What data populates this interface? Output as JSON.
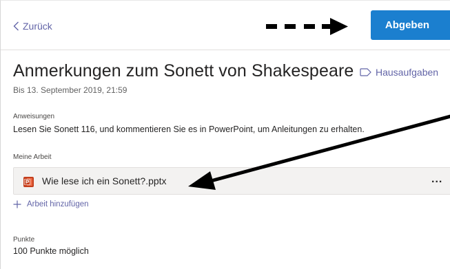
{
  "header": {
    "back_label": "Zurück",
    "submit_label": "Abgeben"
  },
  "assignment": {
    "title": "Anmerkungen zum Sonett von Shakespeare",
    "category": "Hausaufgaben",
    "due": "Bis 13. September 2019, 21:59"
  },
  "instructions": {
    "label": "Anweisungen",
    "text": "Lesen Sie Sonett 116, und kommentieren Sie es in PowerPoint, um Anleitungen zu erhalten."
  },
  "my_work": {
    "label": "Meine Arbeit",
    "file_name": "Wie lese ich ein Sonett?.pptx",
    "file_icon": "powerpoint-icon",
    "more_label": "...",
    "add_label": "Arbeit hinzufügen"
  },
  "points": {
    "label": "Punkte",
    "text": "100 Punkte möglich"
  },
  "colors": {
    "accent": "#6264a7",
    "submit_button": "#1b7fcf",
    "powerpoint": "#c43e1c"
  }
}
